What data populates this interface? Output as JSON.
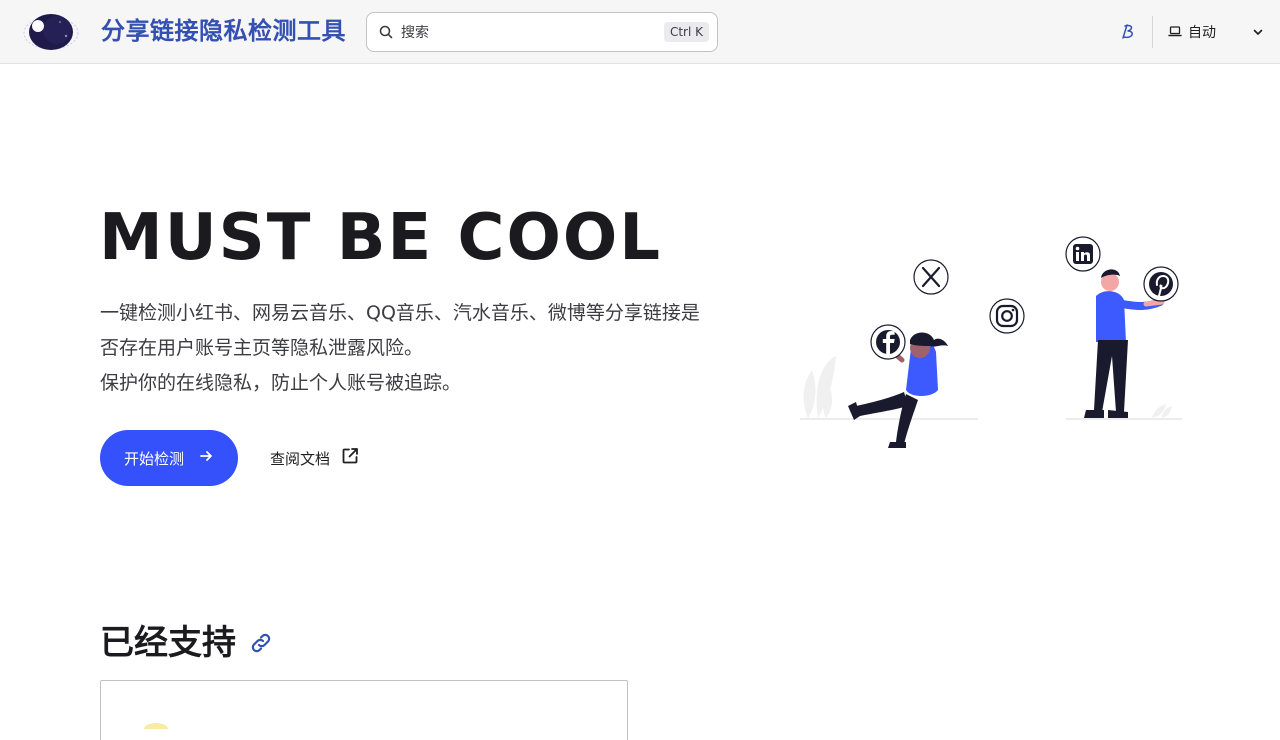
{
  "header": {
    "site_title": "分享链接隐私检测工具",
    "search": {
      "placeholder": "搜索",
      "shortcut": "Ctrl K"
    },
    "theme": {
      "label": "自动"
    }
  },
  "hero": {
    "title": "MUST BE COOL",
    "description_lines": [
      "一键检测小红书、网易云音乐、QQ音乐、汽水音乐、微博等分享链接是",
      "否存在用户账号主页等隐私泄露风险。",
      "保护你的在线隐私，防止个人账号被追踪。"
    ],
    "primary_button": "开始检测",
    "secondary_link": "查阅文档"
  },
  "illustration": {
    "social_icons": [
      "x-icon",
      "facebook-icon",
      "instagram-icon",
      "linkedin-icon",
      "pinterest-icon"
    ]
  },
  "section": {
    "title": "已经支持"
  },
  "colors": {
    "brand": "#3451b2",
    "primary_button": "#3451fb",
    "figure_shirt": "#3d5afe",
    "figure_skin_f": "#a0616a",
    "figure_skin_m": "#f2a6a6"
  }
}
